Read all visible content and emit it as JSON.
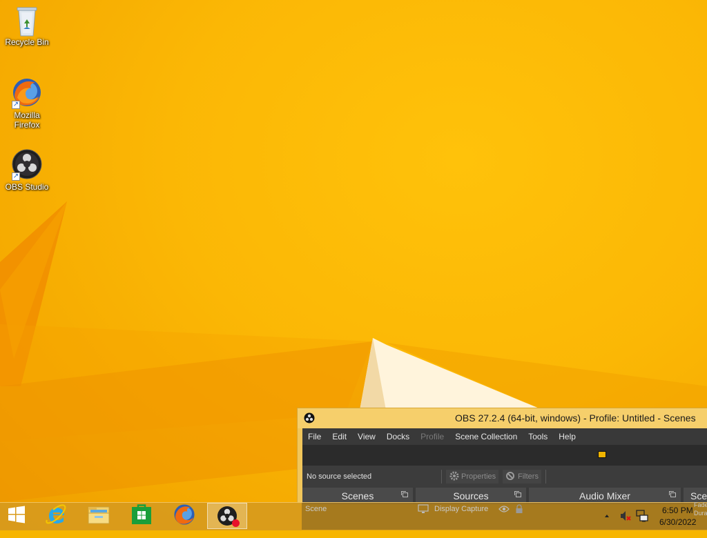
{
  "desktop": {
    "icons": [
      {
        "label": "Recycle Bin"
      },
      {
        "label": "Mozilla\nFirefox"
      },
      {
        "label": "OBS Studio"
      }
    ]
  },
  "obs": {
    "title": "OBS 27.2.4 (64-bit, windows) - Profile: Untitled - Scenes",
    "menu": [
      "File",
      "Edit",
      "View",
      "Docks",
      "Profile",
      "Scene Collection",
      "Tools",
      "Help"
    ],
    "toolbar": {
      "status": "No source selected",
      "properties_label": "Properties",
      "filters_label": "Filters"
    },
    "docks": {
      "scenes": "Scenes",
      "sources": "Sources",
      "audio_mixer": "Audio Mixer",
      "scene_transitions": "Sce"
    },
    "scenes_list": [
      "Scene"
    ],
    "sources_list": [
      {
        "name": "Display Capture"
      }
    ],
    "transition_text": [
      "Fade",
      "Durati"
    ]
  },
  "taskbar": {
    "apps": [
      "start",
      "internet-explorer",
      "file-explorer",
      "store",
      "firefox",
      "obs-studio"
    ],
    "clock": {
      "time": "6:50 PM",
      "date": "6/30/2022"
    }
  }
}
